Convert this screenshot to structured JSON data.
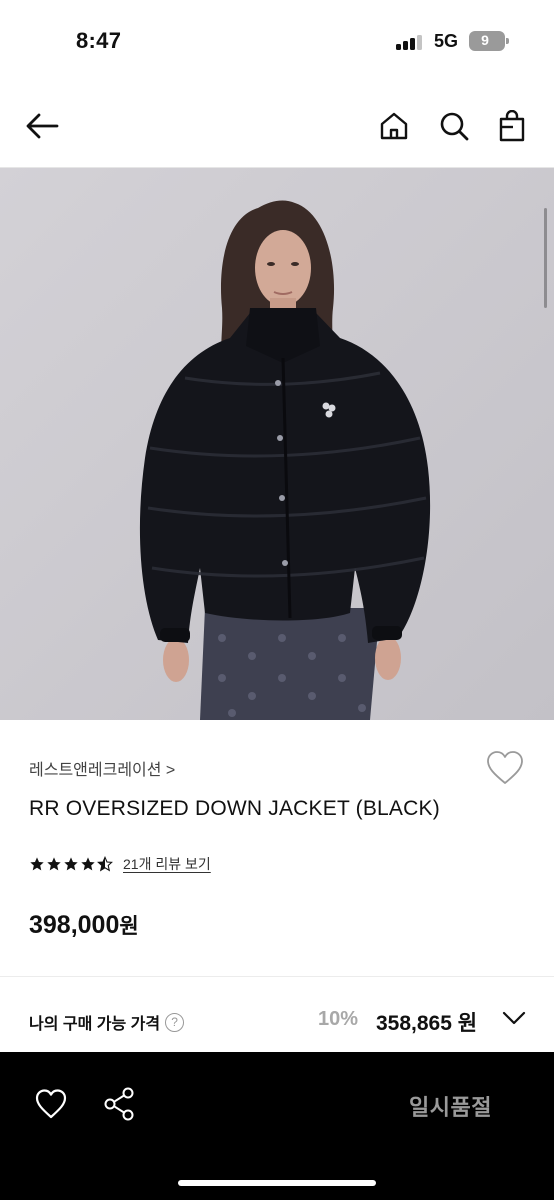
{
  "status_bar": {
    "time": "8:47",
    "network": "5G",
    "battery": "9"
  },
  "nav": {
    "back_icon": "arrow-left-icon",
    "home_icon": "home-icon",
    "search_icon": "search-icon",
    "bag_icon": "shopping-bag-icon"
  },
  "product": {
    "brand": "레스트앤레크레이션 >",
    "title": "RR OVERSIZED DOWN JACKET (BLACK)",
    "rating": 4.5,
    "review_link": "21개 리뷰 보기",
    "price_number": "398,000",
    "price_unit": "원"
  },
  "purchase": {
    "label": "나의 구매 가능 가격",
    "help_glyph": "?",
    "discount": "10%",
    "price_number": "358,865",
    "price_unit": "원"
  },
  "bottom_bar": {
    "sold_out_label": "일시품절",
    "heart_icon": "heart-outline-icon",
    "share_icon": "share-icon"
  },
  "colors": {
    "background": "#ffffff",
    "image_backdrop": "#cfcdd2",
    "bottom_bar": "#000000",
    "muted_text": "#9a9a9a",
    "discount": "#a8a8a8"
  }
}
